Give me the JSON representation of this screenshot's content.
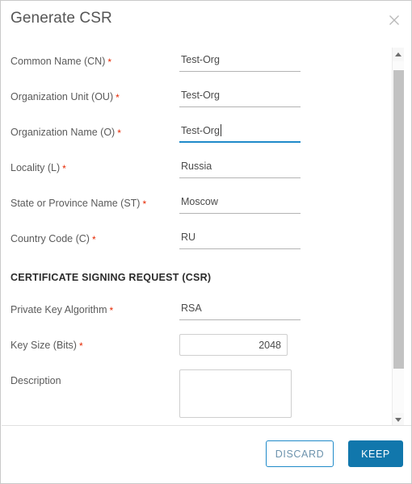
{
  "window": {
    "border_color": "#c9c9c9"
  },
  "header": {
    "title": "Generate CSR",
    "close_icon": "close-icon"
  },
  "form": {
    "fields": [
      {
        "label": "Common Name (CN)",
        "required": true,
        "value": "Test-Org",
        "type": "underline",
        "focused": false
      },
      {
        "label": "Organization Unit (OU)",
        "required": true,
        "value": "Test-Org",
        "type": "underline",
        "focused": false
      },
      {
        "label": "Organization Name (O)",
        "required": true,
        "value": "Test-Org",
        "type": "underline",
        "focused": true
      },
      {
        "label": "Locality (L)",
        "required": true,
        "value": "Russia",
        "type": "underline",
        "focused": false
      },
      {
        "label": "State or Province Name (ST)",
        "required": true,
        "value": "Moscow",
        "type": "underline",
        "focused": false
      },
      {
        "label": "Country Code (C)",
        "required": true,
        "value": "RU",
        "type": "underline",
        "focused": false
      }
    ],
    "section_heading": "CERTIFICATE SIGNING REQUEST (CSR)",
    "csr_fields": [
      {
        "label": "Private Key Algorithm",
        "required": true,
        "value": "RSA",
        "type": "underline",
        "focused": false
      },
      {
        "label": "Key Size (Bits)",
        "required": true,
        "value": "2048",
        "type": "boxed",
        "focused": false
      },
      {
        "label": "Description",
        "required": false,
        "value": "",
        "type": "textarea",
        "focused": false
      }
    ],
    "required_marker": "*"
  },
  "scrollbar": {
    "up_icon": "arrow-up-icon",
    "down_icon": "arrow-down-icon",
    "thumb": "scrollbar-thumb"
  },
  "footer": {
    "discard_label": "DISCARD",
    "keep_label": "KEEP"
  },
  "colors": {
    "accent_blue": "#1177ac",
    "focus_blue": "#1f8ac9",
    "required_red": "#e62700",
    "label_gray": "#5a5a5a",
    "scrollbar_thumb": "#c2c2c2"
  }
}
